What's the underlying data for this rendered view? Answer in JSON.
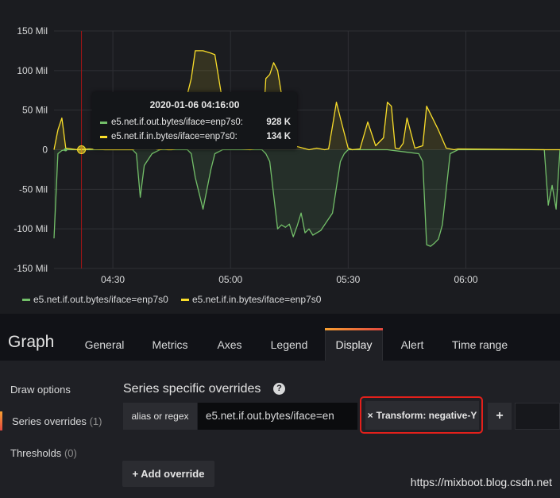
{
  "chart_data": {
    "type": "area",
    "y_unit": "Mil",
    "yticks": [
      "150 Mil",
      "100 Mil",
      "50 Mil",
      "0",
      "-50 Mil",
      "-100 Mil",
      "-150 Mil"
    ],
    "ylim": [
      -150,
      150
    ],
    "xticks": [
      "04:30",
      "05:00",
      "05:30",
      "06:00"
    ],
    "xlim_minutes": [
      255,
      384
    ],
    "grid": true,
    "legend_position": "bottom-left",
    "series": [
      {
        "name": "e5.net.if.out.bytes/iface=enp7s0",
        "color": "#73bf69",
        "x": [
          255,
          256,
          257,
          258,
          261,
          264,
          268,
          272,
          274,
          275,
          276,
          277,
          278,
          280,
          282,
          283,
          284,
          285,
          287,
          289,
          290,
          291,
          293,
          295,
          296,
          298,
          300,
          303,
          305,
          308,
          309,
          310,
          312,
          313,
          314,
          315,
          316,
          317,
          318,
          319,
          320,
          321,
          323,
          326,
          328,
          329,
          330,
          331,
          333,
          335,
          340,
          348,
          349,
          350,
          351,
          352,
          353,
          354,
          356,
          358,
          380,
          381,
          382,
          383,
          384
        ],
        "y": [
          -112,
          -5,
          -1,
          0,
          0,
          0,
          0,
          0,
          0,
          0,
          -5,
          -60,
          -20,
          -5,
          0,
          0,
          0,
          0,
          0,
          0,
          -5,
          -35,
          -75,
          -25,
          -5,
          0,
          0,
          0,
          0,
          0,
          -5,
          -15,
          -100,
          -95,
          -98,
          -94,
          -110,
          -96,
          -80,
          -105,
          -100,
          -108,
          -102,
          -80,
          -15,
          -5,
          0,
          0,
          0,
          0,
          0,
          -5,
          -15,
          -120,
          -122,
          -118,
          -113,
          -95,
          -5,
          0,
          0,
          -70,
          -45,
          -75,
          0
        ]
      },
      {
        "name": "e5.net.if.in.bytes/iface=enp7s0",
        "color": "#fade2a",
        "x": [
          255,
          256,
          257,
          258,
          261,
          264,
          268,
          272,
          274,
          275,
          276,
          277,
          278,
          280,
          282,
          283,
          284,
          285,
          287,
          289,
          290,
          291,
          293,
          295,
          296,
          298,
          300,
          303,
          305,
          307,
          308,
          309,
          310,
          311,
          312,
          313,
          314,
          320,
          321,
          322,
          323,
          324,
          325,
          326,
          327,
          328,
          330,
          331,
          333,
          335,
          337,
          339,
          340,
          341,
          342,
          343,
          344,
          345,
          347,
          349,
          350,
          353,
          355,
          357,
          358,
          380,
          384
        ],
        "y": [
          0,
          25,
          40,
          2,
          0,
          1,
          0,
          0,
          0,
          0,
          2,
          4,
          8,
          2,
          0,
          1,
          0,
          0,
          2,
          70,
          90,
          125,
          125,
          122,
          120,
          60,
          5,
          1,
          0,
          2,
          10,
          90,
          95,
          110,
          100,
          70,
          8,
          0,
          1,
          2,
          1,
          0,
          1,
          30,
          60,
          40,
          2,
          0,
          1,
          35,
          5,
          15,
          60,
          55,
          2,
          1,
          8,
          40,
          2,
          5,
          55,
          25,
          2,
          0,
          1,
          0,
          0
        ]
      }
    ]
  },
  "crosshair_minute": 262,
  "tooltip": {
    "time": "2020-01-06 04:16:00",
    "rows": [
      {
        "name": "e5.net.if.out.bytes/iface=enp7s0:",
        "value": "928 K",
        "color": "#73bf69"
      },
      {
        "name": "e5.net.if.in.bytes/iface=enp7s0:",
        "value": "134 K",
        "color": "#fade2a"
      }
    ]
  },
  "legend": [
    {
      "name": "e5.net.if.out.bytes/iface=enp7s0",
      "color": "#73bf69"
    },
    {
      "name": "e5.net.if.in.bytes/iface=enp7s0",
      "color": "#fade2a"
    }
  ],
  "editor": {
    "title": "Graph",
    "tabs": [
      "General",
      "Metrics",
      "Axes",
      "Legend",
      "Display",
      "Alert",
      "Time range"
    ],
    "active_tab": "Display"
  },
  "sidebar": {
    "items": [
      {
        "label": "Draw options",
        "count": ""
      },
      {
        "label": "Series overrides",
        "count": "(1)"
      },
      {
        "label": "Thresholds",
        "count": "(0)"
      }
    ]
  },
  "overrides": {
    "section_title": "Series specific overrides",
    "alias_label": "alias or regex",
    "alias_value": "e5.net.if.out.bytes/iface=en",
    "transform_label": "Transform: negative-Y",
    "remove_glyph": "×",
    "add_glyph": "+",
    "add_override_label": "Add override"
  },
  "help_glyph": "?",
  "watermark": "https://mixboot.blog.csdn.net"
}
